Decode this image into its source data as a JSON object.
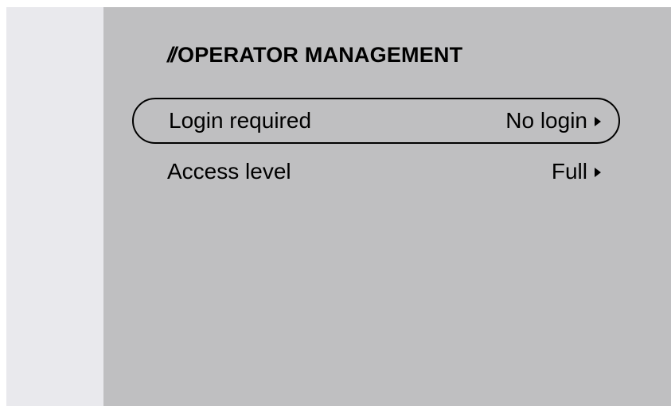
{
  "panel": {
    "title_prefix": "//",
    "title": "OPERATOR MANAGEMENT"
  },
  "menu": {
    "items": [
      {
        "label": "Login required",
        "value": "No login",
        "selected": true,
        "icon": "triangle-right-icon"
      },
      {
        "label": "Access level",
        "value": "Full",
        "selected": false,
        "icon": "triangle-right-icon"
      }
    ]
  },
  "colors": {
    "panel_background": "#bfbfc1",
    "side_strip_background": "#e9e9ed",
    "text": "#000000"
  }
}
